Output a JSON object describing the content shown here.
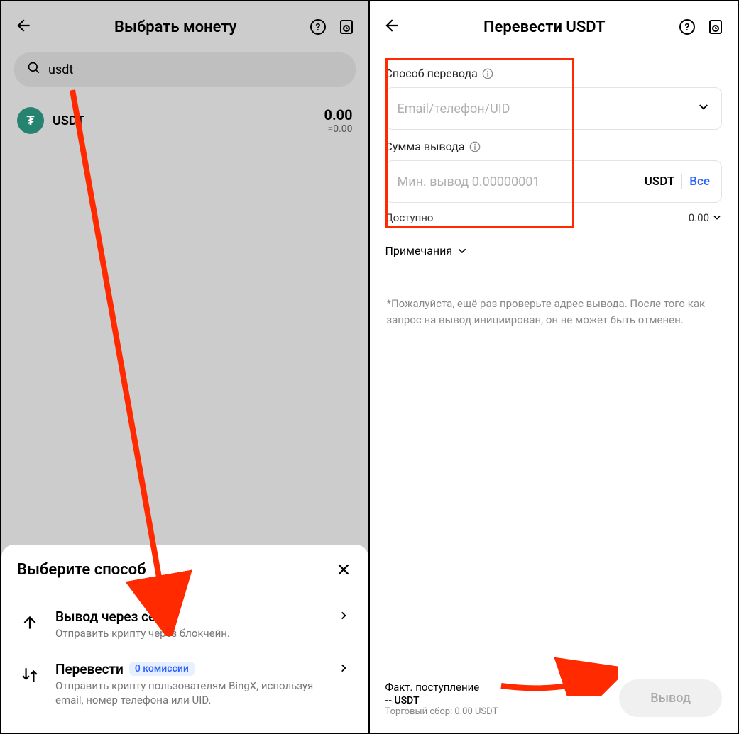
{
  "left": {
    "title": "Выбрать монету",
    "search_value": "usdt",
    "coin": {
      "symbol": "USDT",
      "icon_letter": "₮",
      "balance": "0.00",
      "balance_sub": "=0.00"
    },
    "sheet": {
      "title": "Выберите способ",
      "options": [
        {
          "title": "Вывод через сеть",
          "desc": "Отправить крипту через блокчейн.",
          "icon": "arrow-up"
        },
        {
          "title": "Перевести",
          "badge": "0 комиссии",
          "desc": "Отправить крипту пользователям BingX, используя email, номер телефона или UID.",
          "icon": "swap"
        }
      ]
    }
  },
  "right": {
    "title": "Перевести USDT",
    "method_label": "Способ перевода",
    "method_placeholder": "Email/телефон/UID",
    "amount_label": "Сумма вывода",
    "amount_placeholder": "Мин. вывод 0.00000001",
    "currency": "USDT",
    "all_label": "Все",
    "available_label": "Доступно",
    "available_value": "0.00",
    "notes_label": "Примечания",
    "disclaimer": "*Пожалуйста, ещё раз проверьте адрес вывода. После того как запрос на вывод инициирован, он не может быть отменен.",
    "footer": {
      "actual_label": "Факт. поступление",
      "actual_value": "-- USDT",
      "fee": "Торговый сбор: 0.00 USDT",
      "submit": "Вывод"
    }
  }
}
